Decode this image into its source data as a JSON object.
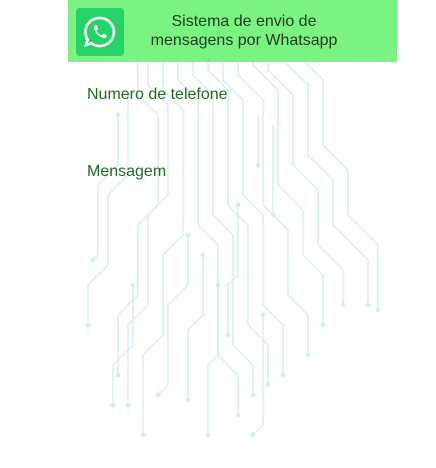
{
  "header": {
    "title_line1": "Sistema de envio de",
    "title_line2": "mensagens por Whatsapp",
    "logo_icon": "whatsapp-icon"
  },
  "form": {
    "phone_label": "Numero de telefone",
    "phone_value": "",
    "message_label": "Mensagem",
    "message_value": ""
  },
  "colors": {
    "header_bg": "#7cf283",
    "logo_bg": "#25d366",
    "label_color": "#1f6b22",
    "circuit_color": "#cfeef0"
  },
  "background_icon": "circuit-pattern"
}
